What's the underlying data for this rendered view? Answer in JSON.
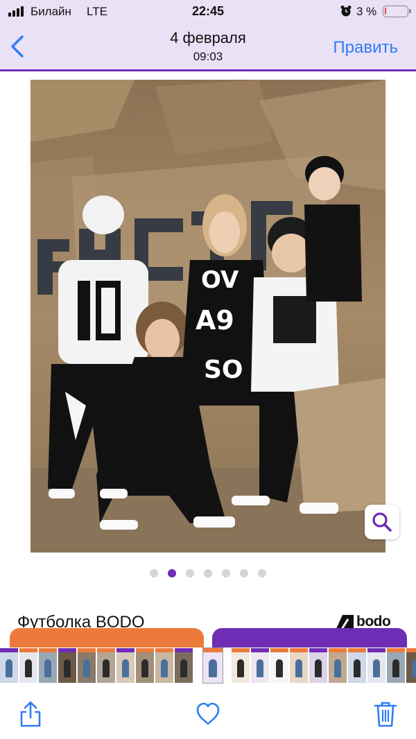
{
  "status_bar": {
    "carrier": "Билайн",
    "network": "LTE",
    "time": "22:45",
    "battery_percent": "3 %",
    "battery_level": 0.03,
    "alarm_icon": "alarm-clock-icon"
  },
  "nav": {
    "back_icon": "chevron-left-icon",
    "title": "4 февраля",
    "subtitle": "09:03",
    "edit_label": "Править"
  },
  "photo": {
    "description_icon": "photo-children-fashion",
    "lookup_icon": "visual-lookup-icon"
  },
  "pager": {
    "count": 7,
    "active_index": 1
  },
  "caption": {
    "text": "Футболка BODO",
    "brand": "bodo"
  },
  "colors": {
    "accent": "#6e2db4",
    "link": "#2f7bf6",
    "orange": "#ec7a3a",
    "nav_bg": "#e9e1f6"
  },
  "toolbar": {
    "share_icon": "share-icon",
    "favorite_icon": "heart-icon",
    "delete_icon": "trash-icon"
  }
}
